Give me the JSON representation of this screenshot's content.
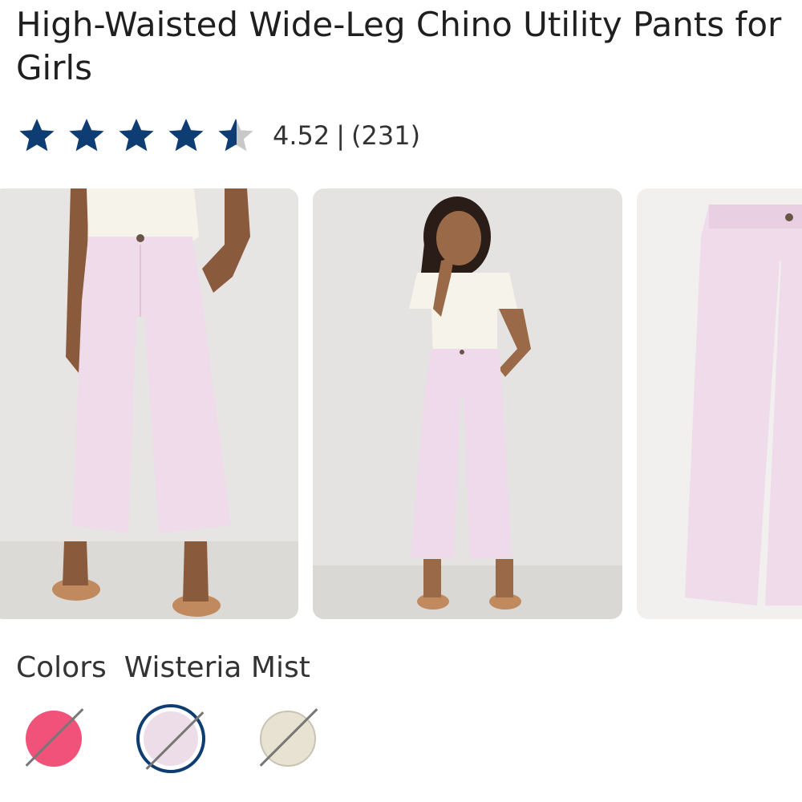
{
  "product": {
    "title": "High-Waisted Wide-Leg Chino Utility Pants for Girls"
  },
  "rating": {
    "value": "4.52",
    "separator": "|",
    "count": "(231)",
    "stars_filled": 4.52,
    "stars_total": 5,
    "star_color": "#0d3d73",
    "star_empty_color": "#c8c8c8"
  },
  "gallery": {
    "images": [
      {
        "name": "pants-front-closeup-photo"
      },
      {
        "name": "girl-wearing-pants-photo"
      },
      {
        "name": "pants-flat-product-photo"
      }
    ]
  },
  "colors": {
    "label": "Colors",
    "selected_name": "Wisteria Mist",
    "swatches": [
      {
        "color": "#f0527a",
        "selected": false,
        "unavailable": true
      },
      {
        "color": "#ecdde8",
        "selected": true,
        "unavailable": true
      },
      {
        "color": "#e8e2d3",
        "selected": false,
        "unavailable": true
      }
    ],
    "selected_border_color": "#0d3d73"
  }
}
